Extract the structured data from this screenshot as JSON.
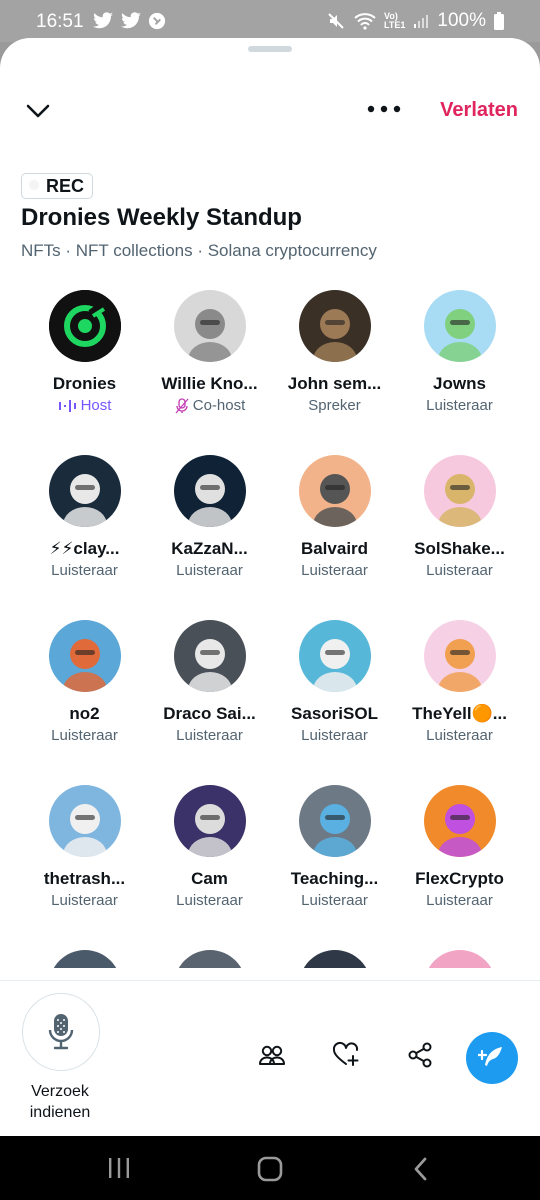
{
  "status_bar": {
    "time": "16:51",
    "battery": "100%"
  },
  "header": {
    "leave_label": "Verlaten"
  },
  "space": {
    "rec_label": "REC",
    "title": "Dronies Weekly Standup",
    "topics": "NFTs · NFT collections · Solana cryptocurrency"
  },
  "participants": [
    {
      "name": "Dronies",
      "role": "Host",
      "avatar_color": "#111111",
      "accent": "#1ed760"
    },
    {
      "name": "Willie Kno...",
      "role": "Co-host",
      "avatar_color": "#d8d8d8",
      "accent": "#8a8a8a"
    },
    {
      "name": "John sem...",
      "role": "Spreker",
      "avatar_color": "#3b3026",
      "accent": "#9b7a55"
    },
    {
      "name": "Jowns",
      "role": "Luisteraar",
      "avatar_color": "#a8dcf4",
      "accent": "#80d080"
    },
    {
      "name": "⚡⚡clay...",
      "role": "Luisteraar",
      "avatar_color": "#1a2b3c",
      "accent": "#e8e8e8"
    },
    {
      "name": "KaZzaN...",
      "role": "Luisteraar",
      "avatar_color": "#0f2236",
      "accent": "#e0e0e0"
    },
    {
      "name": "Balvaird",
      "role": "Luisteraar",
      "avatar_color": "#f2b38a",
      "accent": "#555555"
    },
    {
      "name": "SolShake...",
      "role": "Luisteraar",
      "avatar_color": "#f6c9df",
      "accent": "#d8b56a"
    },
    {
      "name": "no2",
      "role": "Luisteraar",
      "avatar_color": "#5aa7d8",
      "accent": "#e06a3a"
    },
    {
      "name": "Draco Sai...",
      "role": "Luisteraar",
      "avatar_color": "#4a5058",
      "accent": "#e8e8e8"
    },
    {
      "name": "SasoriSOL",
      "role": "Luisteraar",
      "avatar_color": "#56b7d9",
      "accent": "#f0f0f0"
    },
    {
      "name": "TheYell🟠...",
      "role": "Luisteraar",
      "avatar_color": "#f6d1e6",
      "accent": "#f0a050"
    },
    {
      "name": "thetrash...",
      "role": "Luisteraar",
      "avatar_color": "#7fb6e0",
      "accent": "#f0f0f0"
    },
    {
      "name": "Cam",
      "role": "Luisteraar",
      "avatar_color": "#3a3268",
      "accent": "#dcdcdc"
    },
    {
      "name": "Teaching...",
      "role": "Luisteraar",
      "avatar_color": "#6d7a86",
      "accent": "#5ab0e0"
    },
    {
      "name": "FlexCrypto",
      "role": "Luisteraar",
      "avatar_color": "#f08a2a",
      "accent": "#c050e0"
    },
    {
      "name": "",
      "role": "",
      "avatar_color": "#4b5a6a",
      "accent": "#a050d0"
    },
    {
      "name": "",
      "role": "",
      "avatar_color": "#5a6470",
      "accent": "#dcdcdc"
    },
    {
      "name": "",
      "role": "",
      "avatar_color": "#2e3846",
      "accent": "#dcdcdc"
    },
    {
      "name": "",
      "role": "",
      "avatar_color": "#f2a4c4",
      "accent": "#b04ad8"
    }
  ],
  "bottom": {
    "request_label": "Verzoek indienen"
  },
  "icons": [
    "chevron-down-icon",
    "more-icon",
    "mic-icon",
    "people-icon",
    "heart-plus-icon",
    "share-icon",
    "compose-icon",
    "recents-icon",
    "home-icon",
    "back-icon"
  ],
  "colors": {
    "leave": "#e0245e",
    "accent_blue": "#1d9bf0",
    "host_purple": "#7856ff",
    "text_secondary": "#536471"
  }
}
